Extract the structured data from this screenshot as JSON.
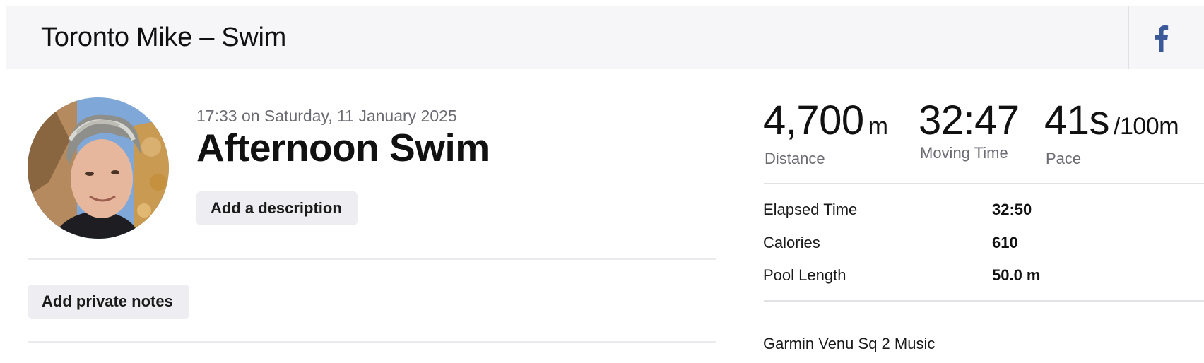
{
  "header": {
    "title": "Toronto Mike – Swim",
    "share_icon": "facebook-icon",
    "share_color": "#3b5998"
  },
  "activity": {
    "datetime": "17:33 on Saturday, 11 January 2025",
    "title": "Afternoon Swim",
    "add_description_label": "Add a description",
    "add_private_notes_label": "Add private notes"
  },
  "stats": {
    "distance": {
      "value": "4,700",
      "unit": "m",
      "label": "Distance"
    },
    "moving_time": {
      "value": "32:47",
      "label": "Moving Time"
    },
    "pace": {
      "value": "41s",
      "unit": "/100m",
      "label": "Pace"
    }
  },
  "details": [
    {
      "label": "Elapsed Time",
      "value": "32:50"
    },
    {
      "label": "Calories",
      "value": "610"
    },
    {
      "label": "Pool Length",
      "value": "50.0 m"
    }
  ],
  "device": "Garmin Venu Sq 2 Music"
}
